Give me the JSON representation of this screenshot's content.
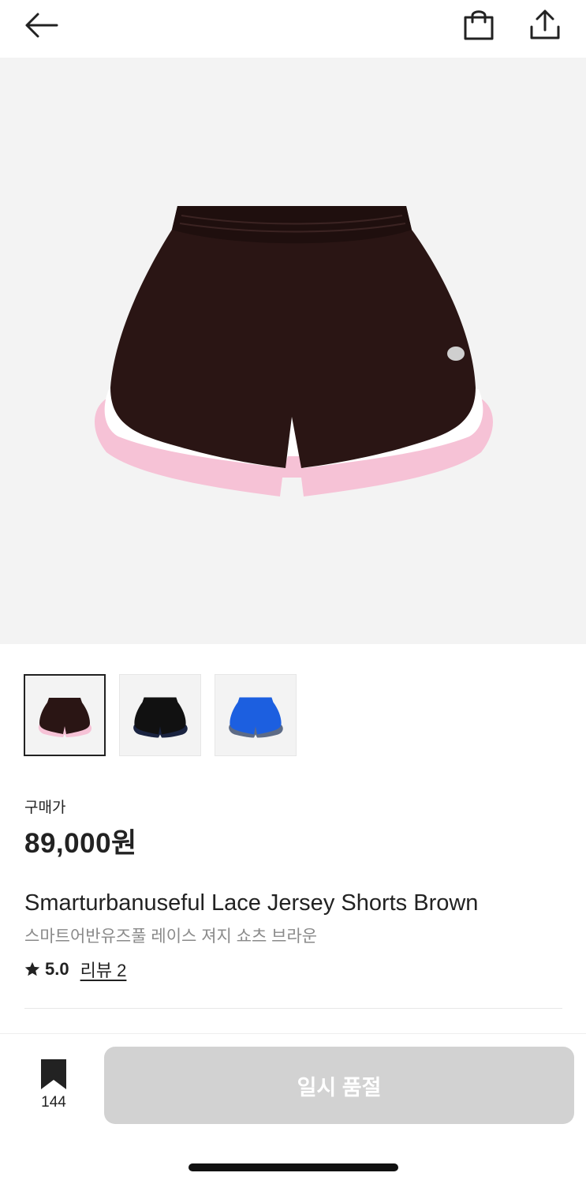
{
  "icons": {
    "back": "arrow-left-icon",
    "cart": "shopping-bag-icon",
    "share": "share-icon",
    "star": "star-icon",
    "bookmark": "bookmark-icon"
  },
  "product": {
    "image_alt": "product-image",
    "thumbnails": [
      "brown",
      "black",
      "blue"
    ],
    "price_label": "구매가",
    "price": "89,000원",
    "name_en": "Smarturbanuseful Lace Jersey Shorts Brown",
    "name_ko": "스마트어반유즈풀 레이스 져지 쇼츠 브라운",
    "rating": "5.0",
    "review_link": "리뷰 2"
  },
  "footer": {
    "bookmark_count": "144",
    "cta_label": "일시 품절"
  },
  "colors": {
    "shorts_brown": "#2a1514",
    "shorts_black": "#111111",
    "shorts_blue": "#1c5fe0",
    "trim_pink": "#f6c2d6",
    "cta_disabled": "#d2d2d2"
  }
}
